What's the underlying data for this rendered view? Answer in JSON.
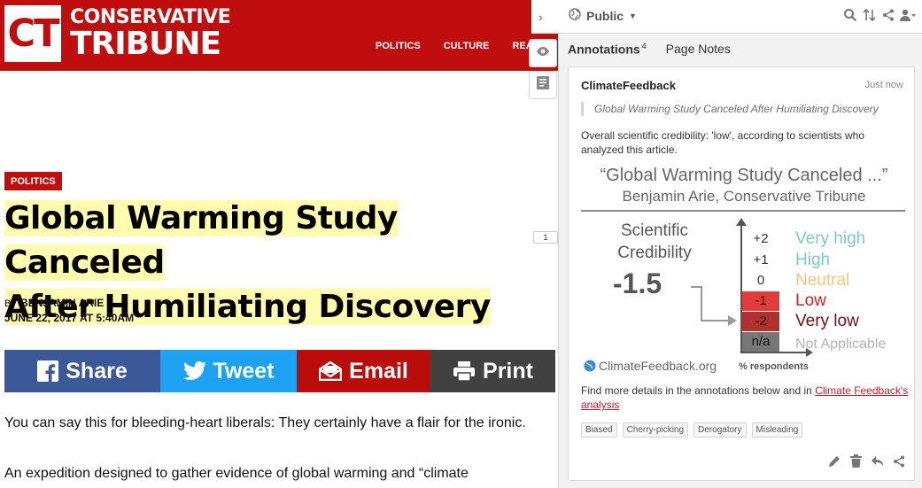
{
  "site": {
    "logo_mark": "CT",
    "logo_line1": "CONSERVATIVE",
    "logo_line2": "TRIBUNE",
    "nav": [
      "POLITICS",
      "CULTURE",
      "REAL"
    ]
  },
  "article": {
    "category": "POLITICS",
    "headline_line1": "Global Warming Study Canceled",
    "headline_line2": "After Humiliating Discovery",
    "by_prefix": "BY",
    "author": "BENJAMIN ARIE",
    "date": "JUNE 22, 2017 AT 5:40AM",
    "share_buttons": {
      "facebook": "Share",
      "twitter": "Tweet",
      "email": "Email",
      "print": "Print"
    },
    "paragraph1": "You can say this for bleeding-heart liberals: They certainly have a flair for the ironic.",
    "paragraph2": "An expedition designed to gather evidence of global warming and “climate",
    "annotation_count_marker": "1"
  },
  "sidebar": {
    "chevron": "›",
    "scope": "Public",
    "tabs": {
      "annotations_label": "Annotations",
      "annotations_count": "4",
      "page_notes_label": "Page Notes"
    },
    "annotation": {
      "user": "ClimateFeedback",
      "time": "Just now",
      "quote": "Global Warming Study Canceled After Humiliating Discovery",
      "text": "Overall scientific credibility: 'low', according to scientists who analyzed this article.",
      "graphic": {
        "title": "“Global Warming Study Canceled ...”",
        "subtitle": "Benjamin Arie, Conservative Tribune",
        "score_label_line1": "Scientific",
        "score_label_line2": "Credibility",
        "score": "-1.5",
        "levels": [
          {
            "value": "+2",
            "label": "Very high",
            "color": "#7fc9c0"
          },
          {
            "value": "+1",
            "label": "High",
            "color": "#7fc9c0"
          },
          {
            "value": "0",
            "label": "Neutral",
            "color": "#f5c77a"
          },
          {
            "value": "-1",
            "label": "Low",
            "color": "#d41f1f"
          },
          {
            "value": "-2",
            "label": "Very low",
            "color": "#7a0f0f"
          },
          {
            "value": "n/a",
            "label": "Not Applicable",
            "color": "#b3b3b3"
          }
        ],
        "source": "ClimateFeedback.org",
        "axis_caption": "% respondents"
      },
      "more_text": "Find more details in the annotations below and in",
      "link_text": "Climate Feedback's analysis",
      "tags": [
        "Biased",
        "Cherry-picking",
        "Derogatory",
        "Misleading"
      ]
    }
  },
  "colors": {
    "brand_red": "#c00d0d",
    "facebook": "#3b5998",
    "twitter": "#1da1f2",
    "email": "#bb0c0c",
    "print": "#414141",
    "highlight": "#fffcb0"
  }
}
